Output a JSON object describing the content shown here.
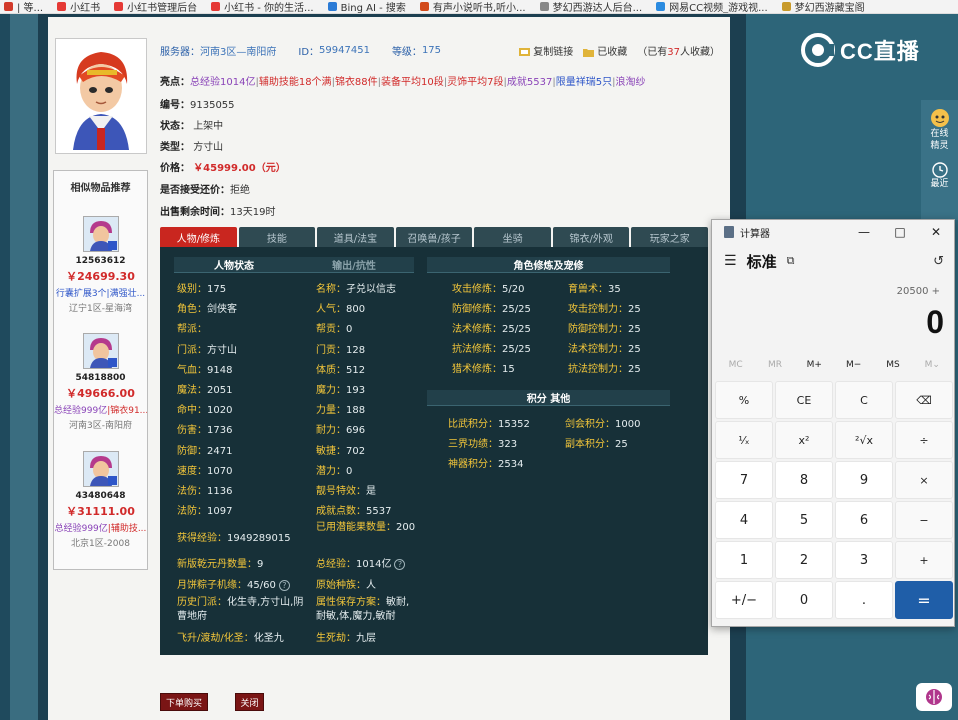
{
  "bookmarks": [
    {
      "label": "| 等...",
      "color": "#d23a2a"
    },
    {
      "label": "小红书",
      "color": "#e53935"
    },
    {
      "label": "小红书管理后台",
      "color": "#e53935"
    },
    {
      "label": "小红书 - 你的生活...",
      "color": "#e53935"
    },
    {
      "label": "Bing AI - 搜索",
      "color": "#2b7bd6"
    },
    {
      "label": "有声小说听书,听小...",
      "color": "#d24a1a"
    },
    {
      "label": "梦幻西游达人后台...",
      "color": "#888888"
    },
    {
      "label": "网易CC视频_游戏视...",
      "color": "#2b8be0"
    },
    {
      "label": "梦幻西游藏宝阁",
      "color": "#c89a2a"
    }
  ],
  "listing": {
    "server_label": "服务器：",
    "server": "河南3区—南阳府",
    "id_label": "ID：",
    "id": "59947451",
    "level_label": "等级：",
    "level": "175",
    "copy_link": "复制链接",
    "favorited": "已收藏",
    "fav_count_prefix": "（已有",
    "fav_count": "37",
    "fav_count_suffix": "人收藏）",
    "highlights_label": "亮点：",
    "highlights": [
      {
        "text": "总经验1014亿",
        "c": "a"
      },
      {
        "text": "辅助技能18个满",
        "c": "r"
      },
      {
        "text": "锦衣88件",
        "c": "r"
      },
      {
        "text": "装备平均10段",
        "c": "r"
      },
      {
        "text": "灵饰平均7段",
        "c": "r"
      },
      {
        "text": "成就5537",
        "c": "a"
      },
      {
        "text": "限量祥瑞5只",
        "c": "b"
      },
      {
        "text": "浪淘纱",
        "c": "a"
      }
    ],
    "number_label": "编号：",
    "number": "9135055",
    "status_label": "状态：",
    "status": "上架中",
    "type_label": "类型：",
    "type": "方寸山",
    "price_label": "价格：",
    "price": "￥45999.00（元）",
    "bargain_label": "是否接受还价：",
    "bargain": "拒绝",
    "remaining_label": "出售剩余时间：",
    "remaining": "13天19时"
  },
  "similar": {
    "title": "相似物品推荐",
    "items": [
      {
        "id": "12563612",
        "price": "￥24699.30",
        "tag1": "行囊扩展3个",
        "tag2": "|满强壮...",
        "server": "辽宁1区-星海湾"
      },
      {
        "id": "54818800",
        "price": "￥49666.00",
        "tag1": "总经验999亿",
        "tag2": "|锦衣91...",
        "server": "河南3区-南阳府"
      },
      {
        "id": "43480648",
        "price": "￥31111.00",
        "tag1": "总经验999亿",
        "tag2": "|辅助技...",
        "server": "北京1区-2008"
      }
    ]
  },
  "tabs": [
    "人物/修炼",
    "技能",
    "道具/法宝",
    "召唤兽/孩子",
    "坐骑",
    "锦衣/外观",
    "玩家之家"
  ],
  "panel": {
    "head_char": "人物状态",
    "head_output": "输出/抗性",
    "head_cult": "角色修炼及宠修",
    "head_points": "积分  其他",
    "left": [
      {
        "k": "级别：",
        "v": "175"
      },
      {
        "k": "角色：",
        "v": "剑侠客"
      },
      {
        "k": "帮派：",
        "v": ""
      },
      {
        "k": "门派：",
        "v": "方寸山"
      },
      {
        "k": "气血：",
        "v": "9148"
      },
      {
        "k": "魔法：",
        "v": "2051"
      },
      {
        "k": "命中：",
        "v": "1020"
      },
      {
        "k": "伤害：",
        "v": "1736"
      },
      {
        "k": "防御：",
        "v": "2471"
      },
      {
        "k": "速度：",
        "v": "1070"
      },
      {
        "k": "法伤：",
        "v": "1136"
      },
      {
        "k": "法防：",
        "v": "1097"
      }
    ],
    "mid": [
      {
        "k": "名称：",
        "v": "孑兑以信志"
      },
      {
        "k": "人气：",
        "v": "800"
      },
      {
        "k": "帮贡：",
        "v": "0"
      },
      {
        "k": "门贡：",
        "v": "128"
      },
      {
        "k": "体质：",
        "v": "512"
      },
      {
        "k": "魔力：",
        "v": "193"
      },
      {
        "k": "力量：",
        "v": "188"
      },
      {
        "k": "耐力：",
        "v": "696"
      },
      {
        "k": "敏捷：",
        "v": "702"
      },
      {
        "k": "潜力：",
        "v": "0"
      },
      {
        "k": "靓号特效：",
        "v": "是"
      },
      {
        "k": "成就点数：",
        "v": "5537"
      }
    ],
    "exp_k": "获得经验：",
    "exp_v": "1949289015",
    "potential_k": "已用潜能果数量：",
    "potential_v": "200",
    "qiankun_k": "新版乾元丹数量：",
    "qiankun_v": "9",
    "total_exp_k": "总经验：",
    "total_exp_v": "1014亿",
    "zongzi_k": "月饼粽子机缘：",
    "zongzi_v": "45/60",
    "race_k": "原始种族：",
    "race_v": "人",
    "history_k": "历史门派：",
    "history_v": "化生寺,方寸山,阴曹地府",
    "save_k": "属性保存方案：",
    "save_v": "敏耐,耐敏,体,魔力,敏耐",
    "ascend_k": "飞升/渡劫/化圣：",
    "ascend_v": "化圣九",
    "life_k": "生死劫：",
    "life_v": "九层",
    "cult": [
      {
        "k": "攻击修炼：",
        "v": "5/20",
        "k2": "育兽术：",
        "v2": "35"
      },
      {
        "k": "防御修炼：",
        "v": "25/25",
        "k2": "攻击控制力：",
        "v2": "25"
      },
      {
        "k": "法术修炼：",
        "v": "25/25",
        "k2": "防御控制力：",
        "v2": "25"
      },
      {
        "k": "抗法修炼：",
        "v": "25/25",
        "k2": "法术控制力：",
        "v2": "25"
      },
      {
        "k": "猎术修炼：",
        "v": "15",
        "k2": "抗法控制力：",
        "v2": "25"
      }
    ],
    "points": [
      {
        "k": "比武积分：",
        "v": "15352",
        "k2": "剑会积分：",
        "v2": "1000"
      },
      {
        "k": "三界功绩：",
        "v": "323",
        "k2": "副本积分：",
        "v2": "25"
      },
      {
        "k": "神器积分：",
        "v": "2534",
        "k2": "",
        "v2": ""
      }
    ]
  },
  "buttons": {
    "buy": "下单购买",
    "close": "关闭"
  },
  "cc": {
    "logo": "CC直播",
    "online_a": "在线",
    "online_b": "精灵",
    "latest": "最近"
  },
  "calc": {
    "title": "计算器",
    "mode": "标准",
    "expression": "20500 +",
    "display": "0",
    "memory": [
      {
        "label": "MC",
        "disabled": true
      },
      {
        "label": "MR",
        "disabled": true
      },
      {
        "label": "M+",
        "disabled": false
      },
      {
        "label": "M−",
        "disabled": false
      },
      {
        "label": "MS",
        "disabled": false
      },
      {
        "label": "M⌄",
        "disabled": true
      }
    ],
    "keys": [
      {
        "label": "%",
        "t": "op"
      },
      {
        "label": "CE",
        "t": "op"
      },
      {
        "label": "C",
        "t": "op"
      },
      {
        "label": "⌫",
        "t": "op"
      },
      {
        "label": "¹⁄ₓ",
        "t": "op"
      },
      {
        "label": "x²",
        "t": "op"
      },
      {
        "label": "²√x",
        "t": "op"
      },
      {
        "label": "÷",
        "t": "op"
      },
      {
        "label": "7",
        "t": "num"
      },
      {
        "label": "8",
        "t": "num"
      },
      {
        "label": "9",
        "t": "num"
      },
      {
        "label": "×",
        "t": "op"
      },
      {
        "label": "4",
        "t": "num"
      },
      {
        "label": "5",
        "t": "num"
      },
      {
        "label": "6",
        "t": "num"
      },
      {
        "label": "−",
        "t": "op"
      },
      {
        "label": "1",
        "t": "num"
      },
      {
        "label": "2",
        "t": "num"
      },
      {
        "label": "3",
        "t": "num"
      },
      {
        "label": "+",
        "t": "op"
      },
      {
        "label": "+/−",
        "t": "num"
      },
      {
        "label": "0",
        "t": "num"
      },
      {
        "label": ".",
        "t": "num"
      },
      {
        "label": "=",
        "t": "eq"
      }
    ]
  }
}
